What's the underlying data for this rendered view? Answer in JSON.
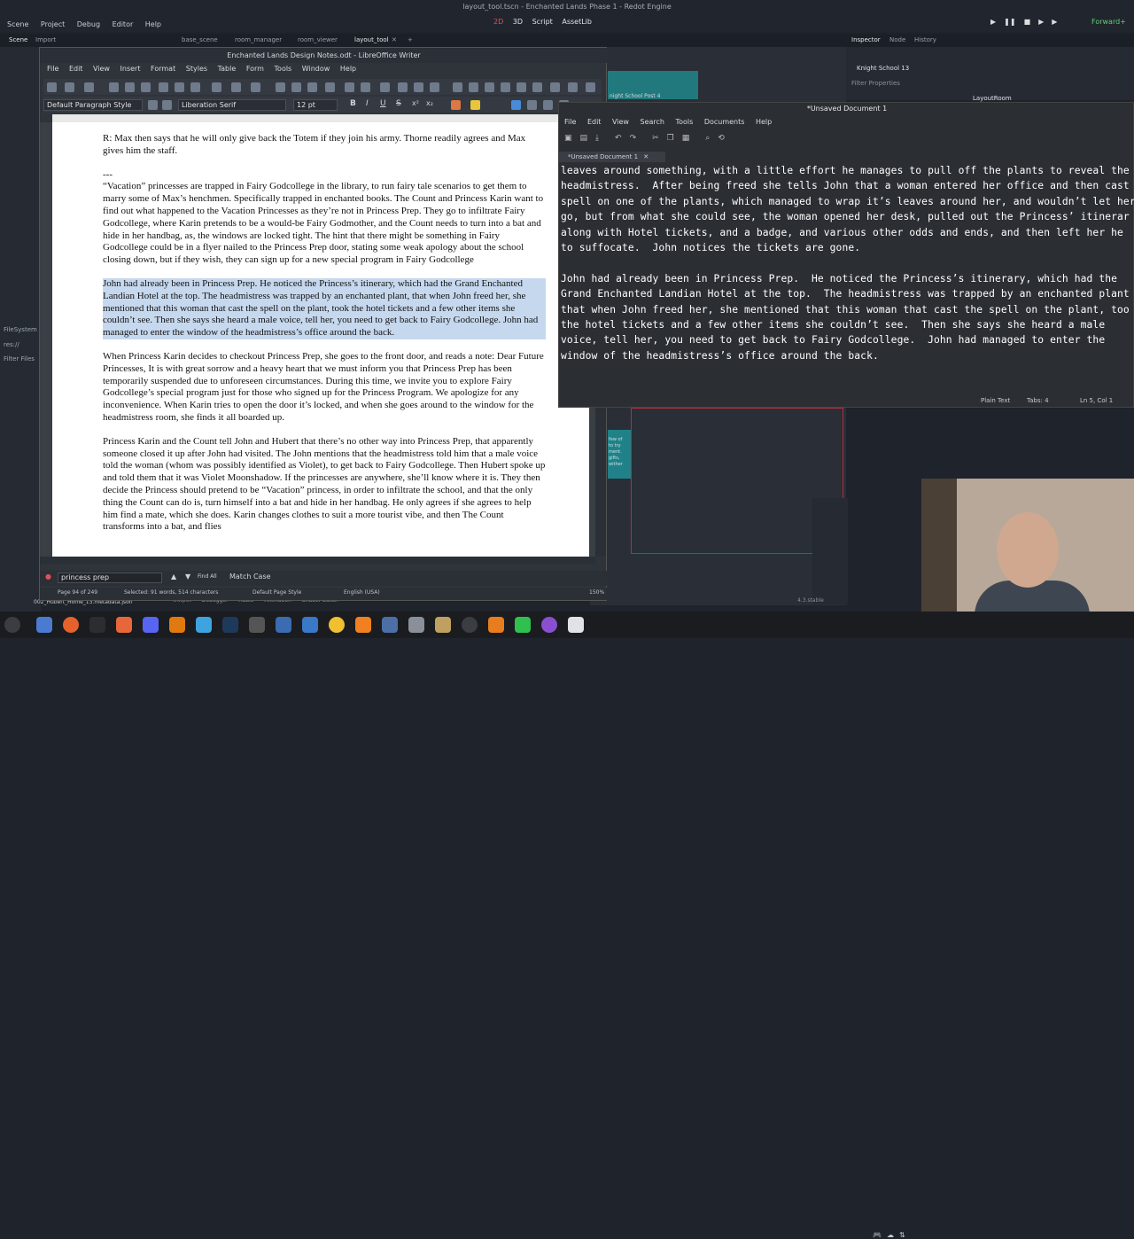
{
  "godot": {
    "window_title": "layout_tool.tscn - Enchanted Lands Phase 1 - Redot Engine",
    "menu": [
      "Scene",
      "Project",
      "Debug",
      "Editor",
      "Help"
    ],
    "modes": [
      "2D",
      "3D",
      "Script",
      "AssetLib"
    ],
    "renderer": "Forward+",
    "scene_tabs_left": [
      "Scene",
      "Import"
    ],
    "scene_tabs": [
      "base_scene",
      "room_manager",
      "room_viewer",
      "layout_tool"
    ],
    "inspector_tabs": [
      "Inspector",
      "Node",
      "History"
    ],
    "inspector_object": "Knight School 13",
    "inspector_filter": "Filter Properties",
    "inspector_node": "LayoutRoom",
    "canvas_label": "night School Post 4",
    "filesystem_label": "FileSystem",
    "filesystem_path": "res://",
    "filter_files": "Filter Files",
    "file_item": "002_Hubert_Home_13.metadata.json",
    "bottom_tabs": [
      "Output",
      "Debugger",
      "Audio",
      "Animation",
      "Shader Editor"
    ],
    "version": "4.3.stable",
    "teal_note": "few of\nto try\nment.\ngifts,\nwither"
  },
  "writer": {
    "title": "Enchanted Lands Design Notes.odt - LibreOffice Writer",
    "menu": [
      "File",
      "Edit",
      "View",
      "Insert",
      "Format",
      "Styles",
      "Table",
      "Form",
      "Tools",
      "Window",
      "Help"
    ],
    "paragraph_style": "Default Paragraph Style",
    "font_name": "Liberation Serif",
    "font_size": "12 pt",
    "paragraphs": [
      "R: Max then says that he will only give back the Totem if they join his army.  Thorne readily agrees and Max gives him the staff.",
      "---\n“Vacation” princesses are trapped in Fairy Godcollege in the library, to run fairy tale scenarios to get them to marry some of Max’s henchmen.  Specifically trapped in enchanted books.  The Count and Princess Karin want to find out what happened to the Vacation Princesses as they’re not in Princess Prep.  They go to infiltrate Fairy Godcollege, where Karin pretends to be a would-be Fairy Godmother, and the Count needs to turn into a bat and hide in her handbag, as, the windows are locked tight.  The hint that there might be something in Fairy Godcollege could be in a flyer nailed to the Princess Prep door, stating some weak apology about the school closing down, but if they wish, they can sign up for a new special program in Fairy Godcollege",
      "John had already been in Princess Prep.  He noticed the Princess’s itinerary, which had the Grand Enchanted Landian Hotel at the top.  The headmistress was trapped by an enchanted plant, that when John freed her, she mentioned that this woman that cast the spell on the plant, took the hotel tickets and a few other items she couldn’t see.  Then she says she heard a male voice, tell her, you need to get back to Fairy Godcollege.  John had managed to enter the window of the headmistress’s office around the back.",
      "When Princess Karin decides to checkout Princess Prep, she goes to the front door, and reads a note: Dear Future Princesses, It is with great sorrow and a heavy heart that we must inform you that Princess Prep has been temporarily suspended due to unforeseen circumstances. During this time, we invite you to explore Fairy Godcollege’s special program just for those who signed up for the Princess Program. We apologize for any inconvenience.  When Karin tries to open the door it’s locked, and when she goes around to the window for the headmistress room, she finds it all boarded up.",
      "Princess Karin and the Count tell John and Hubert that there’s no other way into Princess Prep, that apparently someone closed it up after John had visited.  The John mentions that the headmistress told him that a male voice told the woman (whom was possibly identified as Violet), to get back to Fairy Godcollege.  Then Hubert spoke up and told them that it was Violet Moonshadow.  If the princesses are anywhere, she’ll know where it is.  They then decide the Princess should pretend to be “Vacation” princess, in order to infiltrate the school, and that the only thing the Count can do is, turn himself into a bat and hide in her handbag.  He only agrees if she agrees to help him find a mate, which she does.  Karin changes clothes to suit a more tourist vibe, and then The Count transforms into a bat, and flies"
    ],
    "find_text": "princess prep",
    "find_all": "Find All",
    "match_case": "Match Case",
    "status": {
      "page": "Page 94 of 249",
      "words": "Selected: 91 words, 514 characters",
      "page_style": "Default Page Style",
      "language": "English (USA)",
      "zoom": "150%"
    }
  },
  "gedit": {
    "title": "*Unsaved Document 1",
    "menu": [
      "File",
      "Edit",
      "View",
      "Search",
      "Tools",
      "Documents",
      "Help"
    ],
    "tab": "*Unsaved Document 1",
    "lines": [
      "leaves around something, with a little effort he manages to pull off the plants to reveal the",
      "headmistress.  After being freed she tells John that a woman entered her office and then cast",
      "spell on one of the plants, which managed to wrap it’s leaves around her, and wouldn’t let her",
      "go, but from what she could see, the woman opened her desk, pulled out the Princess’ itinerar",
      "along with Hotel tickets, and a badge, and various other odds and ends, and then left her he",
      "to suffocate.  John notices the tickets are gone.",
      "",
      "John had already been in Princess Prep.  He noticed the Princess’s itinerary, which had the",
      "Grand Enchanted Landian Hotel at the top.  The headmistress was trapped by an enchanted plant",
      "that when John freed her, she mentioned that this woman that cast the spell on the plant, too",
      "the hotel tickets and a few other items she couldn’t see.  Then she says she heard a male",
      "voice, tell her, you need to get back to Fairy Godcollege.  John had managed to enter the",
      "window of the headmistress’s office around the back.",
      ""
    ],
    "status": {
      "mode": "Plain Text",
      "tabs": "Tabs: 4",
      "position": "Ln 5, Col 1"
    }
  }
}
